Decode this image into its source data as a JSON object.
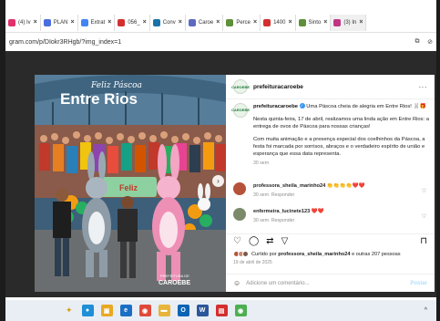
{
  "browser": {
    "tabs": [
      {
        "label": "(4) Iv",
        "color": "#e1306c"
      },
      {
        "label": "PLAN",
        "color": "#4a6ee0"
      },
      {
        "label": "Extrat",
        "color": "#4285f4"
      },
      {
        "label": "056_",
        "color": "#d32f2f"
      },
      {
        "label": "Conv",
        "color": "#1a73a8"
      },
      {
        "label": "Caroe",
        "color": "#5c6bc0"
      },
      {
        "label": "Perce",
        "color": "#5e8f3a"
      },
      {
        "label": "1400",
        "color": "#d32f2f"
      },
      {
        "label": "Sinto",
        "color": "#5e8f3a"
      },
      {
        "label": "(3) In",
        "color": "#c13584"
      }
    ],
    "tab_close": "×",
    "url": "gram.com/p/DIokr3RHgb/?img_index=1"
  },
  "post": {
    "image_text": {
      "script": "Feliz Páscoa",
      "title": "Entre Rios",
      "banner": "Feliz",
      "logo_top": "PREFEITURA DE",
      "logo_bottom": "CAROEBE"
    },
    "account": "prefeituracaroebe",
    "avatar_text": "CAROEBE",
    "more": "···",
    "caption_head": "Uma Páscoa cheia de alegria em Entre Rios! 🐰🎁",
    "caption_p1": "Nesta quinta-feira, 17 de abril, realizamos uma linda ação em Entre Rios: a entrega de ovos de Páscoa para nossas crianças!",
    "caption_p2": "Com muita animação e a presença especial dos coelhinhos da Páscoa, a festa foi marcada por sorrisos, abraços e o verdadeiro espírito de união e esperança que essa data representa.",
    "caption_time": "30 sem",
    "comments": [
      {
        "user": "professora_sheila_marinho24",
        "text": "👏👏👏👏❤️❤️",
        "time": "30 sem",
        "reply": "Responder",
        "color": "#b5533a"
      },
      {
        "user": "enfermeira_lucinete123",
        "text": "❤️❤️",
        "time": "30 sem",
        "reply": "Responder",
        "color": "#7a8a6a"
      }
    ],
    "liked_prefix": "Curtido por",
    "liked_user": "professora_sheila_marinho24",
    "liked_suffix": "e outras 207 pessoas",
    "date": "19 de abril de 2025",
    "comment_placeholder": "Adicione um comentário...",
    "post_button": "Postar"
  },
  "taskbar": {
    "items": [
      {
        "icon": "edge-icon",
        "color": "#1f8fd6"
      },
      {
        "icon": "file-explorer-icon",
        "color": "#e8a923"
      },
      {
        "icon": "ie-icon",
        "color": "#1a6fc4"
      },
      {
        "icon": "chrome-icon",
        "color": "#e04a3a"
      },
      {
        "icon": "folder-icon",
        "color": "#e8b53a"
      },
      {
        "icon": "outlook-icon",
        "color": "#0a64b4"
      },
      {
        "icon": "word-icon",
        "color": "#2b579a"
      },
      {
        "icon": "pdf-icon",
        "color": "#d32f2f"
      },
      {
        "icon": "chrome-icon",
        "color": "#4caf50"
      }
    ],
    "up_arrow": "^"
  }
}
